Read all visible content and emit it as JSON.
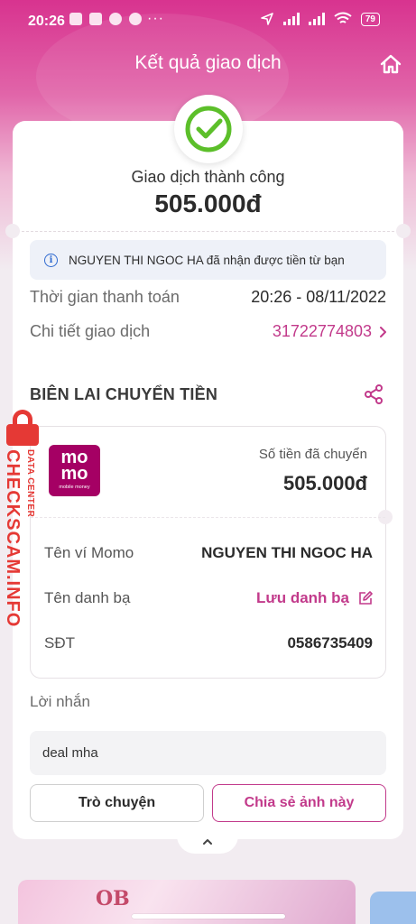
{
  "statusbar": {
    "time": "20:26",
    "dots": "···",
    "battery": "79"
  },
  "header": {
    "title": "Kết quả giao dịch"
  },
  "result": {
    "title": "Giao dịch thành công",
    "amount": "505.000đ"
  },
  "info": {
    "icon_text": "i",
    "message": "NGUYEN THI NGOC HA đã nhận được tiền từ bạn"
  },
  "details": {
    "time_label": "Thời gian thanh toán",
    "time_value": "20:26 - 08/11/2022",
    "txn_label": "Chi tiết giao dịch",
    "txn_value": "31722774803"
  },
  "receipt": {
    "section_title": "BIÊN LAI CHUYỂN TIỀN",
    "logo_line1": "mo",
    "logo_line2": "mo",
    "logo_line3": "mobile money",
    "sent_label": "Số tiền đã chuyển",
    "sent_amount": "505.000đ",
    "wallet_label": "Tên ví Momo",
    "wallet_value": "NGUYEN THI NGOC HA",
    "contact_label": "Tên danh bạ",
    "contact_value": "Lưu danh bạ",
    "phone_label": "SĐT",
    "phone_value": "0586735409"
  },
  "message": {
    "label": "Lời nhắn",
    "value": "deal mha"
  },
  "buttons": {
    "chat": "Trò chuyện",
    "share": "Chia sẻ ảnh này"
  },
  "banner": {
    "text": "OB"
  },
  "watermark": {
    "site": "CHECKSCAM.INFO",
    "sub": "DATA CENTER"
  },
  "colors": {
    "brand": "#c23a8b",
    "momo": "#a50064",
    "success": "#5cbf2a",
    "watermark": "#e53935"
  }
}
